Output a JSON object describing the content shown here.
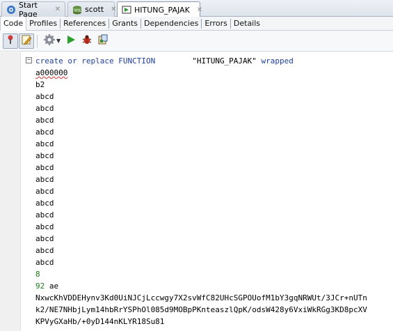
{
  "doc_tabs": [
    {
      "label": "Start Page",
      "icon": "start-page-icon",
      "active": false
    },
    {
      "label": "scott",
      "icon": "sql-worksheet-icon",
      "active": false
    },
    {
      "label": "HITUNG_PAJAK",
      "icon": "function-icon",
      "active": true
    }
  ],
  "sub_tabs": [
    "Code",
    "Profiles",
    "References",
    "Grants",
    "Dependencies",
    "Errors",
    "Details"
  ],
  "toolbar": [
    "pin-icon",
    "edit-icon",
    "gear-icon",
    "run-icon",
    "debug-icon",
    "compile-icon"
  ],
  "editor": {
    "header": {
      "create": "create",
      "or": "or",
      "replace": "replace",
      "function": "FUNCTION",
      "name": "\"HITUNG_PAJAK\"",
      "wrapped": "wrapped"
    },
    "lines": [
      "a000000",
      "b2",
      "abcd",
      "abcd",
      "abcd",
      "abcd",
      "abcd",
      "abcd",
      "abcd",
      "abcd",
      "abcd",
      "abcd",
      "abcd",
      "abcd",
      "abcd",
      "abcd",
      "abcd"
    ],
    "num8": "8",
    "num92": "92",
    "ae": "ae",
    "enc1": "NxwcKhVDDEHynv3Kd0UiNJCjLccwgy7X2svWfC82UHcSGPOUofM1bY3gqNRWUt/3JCr+nUTn",
    "enc2": "k2/NE7NHbjLym14hbRrYSPhOl085d9MOBpPKnteaszlQpK/odsW428y6VxiWkRGg3KD8pcXV",
    "enc3": "KPVyGXaHb/+0yD144nKLYR18Su81"
  }
}
